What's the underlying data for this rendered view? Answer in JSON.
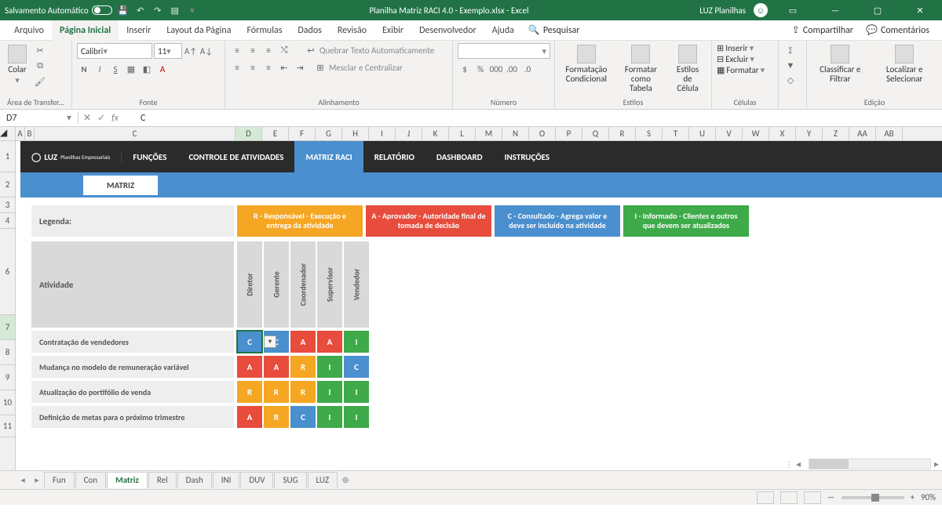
{
  "title_bar": {
    "autosave": "Salvamento Automático",
    "doc_title": "Planilha Matriz RACI 4.0 - Exemplo.xlsx  -  Excel",
    "account": "LUZ Planilhas"
  },
  "menu": {
    "tabs": [
      "Arquivo",
      "Página Inicial",
      "Inserir",
      "Layout da Página",
      "Fórmulas",
      "Dados",
      "Revisão",
      "Exibir",
      "Desenvolvedor",
      "Ajuda"
    ],
    "active": 1,
    "search": "Pesquisar",
    "share": "Compartilhar",
    "comments": "Comentários"
  },
  "ribbon": {
    "clipboard": {
      "paste": "Colar",
      "group": "Área de Transfer..."
    },
    "font": {
      "name": "Calibri",
      "size": "11",
      "group": "Fonte"
    },
    "alignment": {
      "wrap": "Quebrar Texto Automaticamente",
      "merge": "Mesclar e Centralizar",
      "group": "Alinhamento"
    },
    "number": {
      "group": "Número"
    },
    "styles": {
      "cond": "Formatação Condicional",
      "table": "Formatar como Tabela",
      "cell": "Estilos de Célula",
      "group": "Estilos"
    },
    "cells": {
      "insert": "Inserir",
      "delete": "Excluir",
      "format": "Formatar",
      "group": "Células"
    },
    "editing": {
      "sort": "Classificar e Filtrar",
      "find": "Localizar e Selecionar",
      "group": "Edição"
    }
  },
  "namebox": "D7",
  "formula": "C",
  "columns": [
    "A",
    "B",
    "C",
    "D",
    "E",
    "F",
    "G",
    "H",
    "I",
    "J",
    "K",
    "L",
    "M",
    "N",
    "O",
    "P",
    "Q",
    "R",
    "S",
    "T",
    "U",
    "V",
    "W",
    "X",
    "Y",
    "Z",
    "AA",
    "AB"
  ],
  "rows": [
    "1",
    "2",
    "3",
    "4",
    "6",
    "7",
    "8",
    "9",
    "10",
    "11"
  ],
  "active_col": "D",
  "active_row": "7",
  "nav": {
    "logo": "LUZ",
    "sub": "Planilhas Empresariais",
    "items": [
      "FUNÇÕES",
      "CONTROLE DE ATIVIDADES",
      "MATRIZ RACI",
      "RELATÓRIO",
      "DASHBOARD",
      "INSTRUÇÕES"
    ],
    "active": 2,
    "subtab": "MATRIZ"
  },
  "legend": {
    "label": "Legenda:",
    "r": "R - Responsável - Execução e entrega da atividade",
    "a": "A - Aprovador - Autoridade final de tomada de decisão",
    "c": "C - Consultado - Agrega valor e deve ser incluído na atividade",
    "i": "I - Informado - Clientes e outros que devem ser atualizados"
  },
  "matrix": {
    "activity_header": "Atividade",
    "roles": [
      "Diretor",
      "Gerente",
      "Coordenador",
      "Supervisor",
      "Vendedor"
    ],
    "rows": [
      {
        "act": "Contratação de vendedores",
        "vals": [
          "C",
          "C",
          "A",
          "A",
          "I"
        ]
      },
      {
        "act": "Mudança no modelo de remuneração variável",
        "vals": [
          "A",
          "A",
          "R",
          "I",
          "C"
        ]
      },
      {
        "act": "Atualização do portifólio de venda",
        "vals": [
          "R",
          "R",
          "R",
          "I",
          "I"
        ]
      },
      {
        "act": "Definição de metas para o próximo trimestre",
        "vals": [
          "A",
          "R",
          "C",
          "I",
          "I"
        ]
      }
    ]
  },
  "sheets": {
    "tabs": [
      "Fun",
      "Con",
      "Matriz",
      "Rel",
      "Dash",
      "INI",
      "DUV",
      "SUG",
      "LUZ"
    ],
    "active": 2
  },
  "zoom": "90%"
}
